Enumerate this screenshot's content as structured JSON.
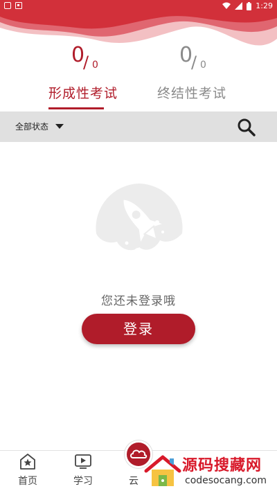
{
  "status_bar": {
    "time": "1:29"
  },
  "tabs": [
    {
      "numerator": "0",
      "denominator": "0",
      "label": "形成性考试",
      "active": true
    },
    {
      "numerator": "0",
      "denominator": "0",
      "label": "终结性考试",
      "active": false
    }
  ],
  "filter": {
    "selected": "全部状态"
  },
  "empty_state": {
    "message": "您还未登录哦",
    "login_label": "登录"
  },
  "bottom_nav": [
    {
      "label": "首页",
      "icon": "home-star-icon"
    },
    {
      "label": "学习",
      "icon": "video-play-icon"
    },
    {
      "label": "云",
      "icon": "cloud-icon"
    }
  ],
  "watermark": {
    "title": "源码搜藏网",
    "subtitle": "codesocang.com"
  },
  "colors": {
    "accent": "#b01c2a",
    "status_bar": "#d2303a",
    "filter_bg": "#e0e0e0"
  }
}
